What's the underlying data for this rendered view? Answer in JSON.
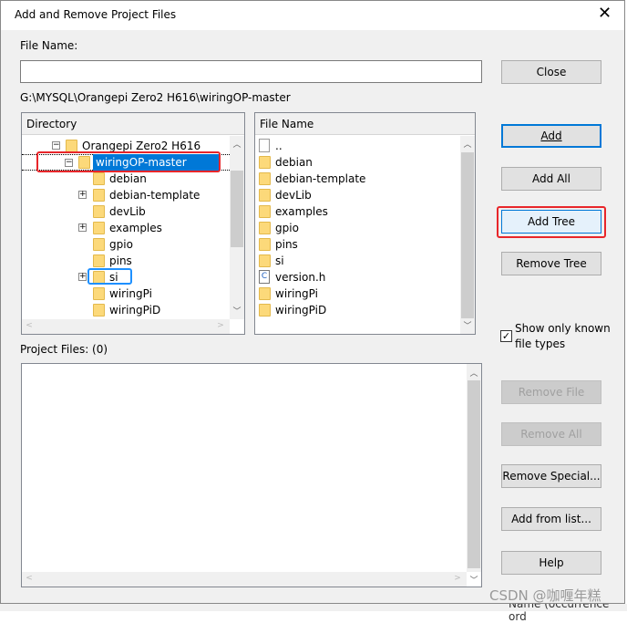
{
  "window": {
    "title": "Add and Remove Project Files",
    "close_icon": "close-icon"
  },
  "file_name": {
    "label": "File Name:",
    "value": ""
  },
  "path": "G:\\MYSQL\\Orangepi Zero2 H616\\wiringOP-master",
  "directory": {
    "header": "Directory",
    "root": "Orangepi Zero2 H616",
    "selected": "wiringOP-master",
    "children": [
      {
        "label": "debian",
        "expandable": false
      },
      {
        "label": "debian-template",
        "expandable": true
      },
      {
        "label": "devLib",
        "expandable": false
      },
      {
        "label": "examples",
        "expandable": true
      },
      {
        "label": "gpio",
        "expandable": false
      },
      {
        "label": "pins",
        "expandable": false
      },
      {
        "label": "si",
        "expandable": true
      },
      {
        "label": "wiringPi",
        "expandable": false
      },
      {
        "label": "wiringPiD",
        "expandable": false
      }
    ]
  },
  "files": {
    "header": "File Name",
    "items": [
      {
        "label": "..",
        "icon": "file"
      },
      {
        "label": "debian",
        "icon": "folder"
      },
      {
        "label": "debian-template",
        "icon": "folder"
      },
      {
        "label": "devLib",
        "icon": "folder"
      },
      {
        "label": "examples",
        "icon": "folder"
      },
      {
        "label": "gpio",
        "icon": "folder"
      },
      {
        "label": "pins",
        "icon": "folder"
      },
      {
        "label": "si",
        "icon": "folder"
      },
      {
        "label": "version.h",
        "icon": "c-file"
      },
      {
        "label": "wiringPi",
        "icon": "folder"
      },
      {
        "label": "wiringPiD",
        "icon": "folder"
      }
    ]
  },
  "buttons": {
    "close": "Close",
    "add": "Add",
    "add_all": "Add All",
    "add_tree": "Add Tree",
    "remove_tree": "Remove Tree",
    "remove_file": "Remove File",
    "remove_all": "Remove All",
    "remove_special": "Remove Special...",
    "add_from_list": "Add from list...",
    "help": "Help"
  },
  "show_known": {
    "label": "Show only known file types",
    "checked": true
  },
  "project_files": {
    "label": "Project Files: (0)"
  },
  "watermark": "CSDN @咖喱年糕",
  "background_text": "Name (occurrence ord",
  "colors": {
    "selection": "#0078d7",
    "highlight_red": "#e8262a",
    "highlight_blue": "#1e90ff"
  }
}
